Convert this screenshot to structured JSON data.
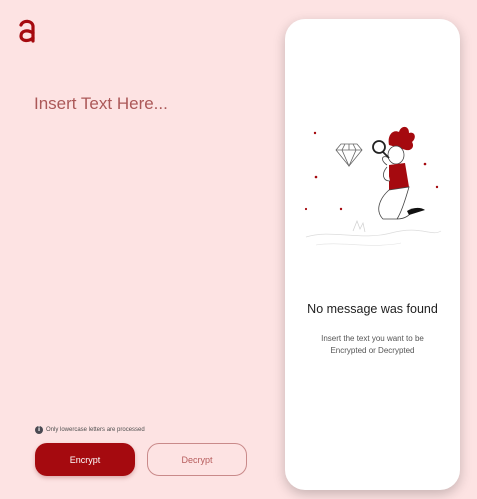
{
  "logo": {
    "icon": "brand-a-logo",
    "color": "#a50a0f"
  },
  "input": {
    "placeholder": "Insert Text Here...",
    "value": ""
  },
  "note": {
    "icon": "info-icon",
    "text": "Only lowercase letters are processed"
  },
  "buttons": {
    "encrypt": "Encrypt",
    "decrypt": "Decrypt"
  },
  "result_panel": {
    "illustration": "person-inspecting-diamond-illustration",
    "title": "No message was found",
    "description": "Insert the text you want to be Encrypted or Decrypted"
  },
  "colors": {
    "background": "#fde3e3",
    "accent": "#a50a0f",
    "panel": "#ffffff",
    "placeholder": "#a34a4a"
  }
}
